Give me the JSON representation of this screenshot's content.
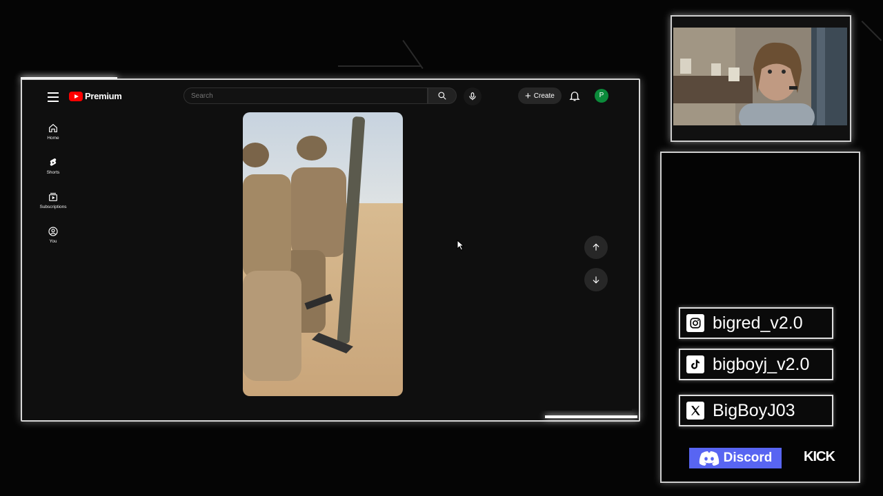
{
  "youtube": {
    "brand": "Premium",
    "search_placeholder": "Search",
    "create_label": "Create",
    "avatar_initial": "P",
    "sidebar": [
      {
        "label": "Home",
        "icon": "home-icon"
      },
      {
        "label": "Shorts",
        "icon": "shorts-icon"
      },
      {
        "label": "Subscriptions",
        "icon": "subscriptions-icon"
      },
      {
        "label": "You",
        "icon": "account-icon"
      }
    ]
  },
  "socials": {
    "instagram": "bigred_v2.0",
    "tiktok": "bigboyj_v2.0",
    "x": "BigBoyJ03",
    "discord": "Discord",
    "kick": "KICK"
  },
  "colors": {
    "youtube_red": "#ff0000",
    "avatar_green": "#0b8a3a",
    "discord_blue": "#5865f2"
  }
}
